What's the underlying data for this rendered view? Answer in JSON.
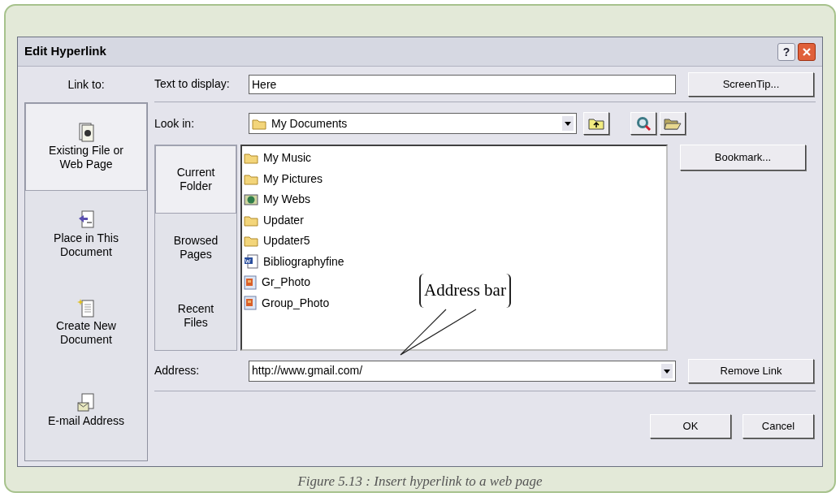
{
  "dialog": {
    "title": "Edit Hyperlink",
    "help": "?",
    "link_to": {
      "label": "Link to:",
      "items": [
        {
          "label": "Existing File or Web Page",
          "selected": true
        },
        {
          "label": "Place in This Document",
          "selected": false
        },
        {
          "label": "Create New Document",
          "selected": false
        },
        {
          "label": "E-mail Address",
          "selected": false
        }
      ]
    },
    "text_to_display": {
      "label": "Text to display:",
      "value": "Here"
    },
    "screentip_button": "ScreenTip...",
    "look_in": {
      "label": "Look in:",
      "value": "My Documents"
    },
    "browse_tabs": [
      {
        "label": "Current Folder",
        "selected": true
      },
      {
        "label": "Browsed Pages",
        "selected": false
      },
      {
        "label": "Recent Files",
        "selected": false
      }
    ],
    "files": [
      {
        "name": "My Music",
        "kind": "folder"
      },
      {
        "name": "My Pictures",
        "kind": "folder"
      },
      {
        "name": "My Webs",
        "kind": "webfolder"
      },
      {
        "name": "Updater",
        "kind": "folder"
      },
      {
        "name": "Updater5",
        "kind": "folder"
      },
      {
        "name": "Bibliographyfine",
        "kind": "document"
      },
      {
        "name": "Gr_Photo",
        "kind": "image"
      },
      {
        "name": "Group_Photo",
        "kind": "image"
      }
    ],
    "bookmark_button": "Bookmark...",
    "address": {
      "label": "Address:",
      "value": "http://www.gmail.com/"
    },
    "remove_link_button": "Remove Link",
    "ok_button": "OK",
    "cancel_button": "Cancel"
  },
  "callout": "Address bar",
  "caption": "Figure 5.13 : Insert hyperlink to a web page"
}
